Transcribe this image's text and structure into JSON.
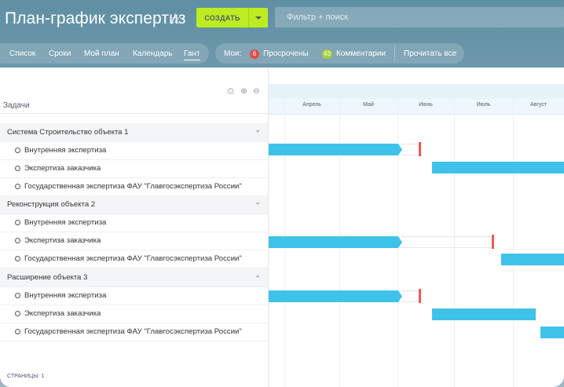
{
  "header": {
    "title": "План-график экспертиз",
    "create_label": "СОЗДАТЬ",
    "search_placeholder": "Фильтр + поиск"
  },
  "nav": {
    "items": [
      {
        "label": "Список"
      },
      {
        "label": "Сроки"
      },
      {
        "label": "Мой план"
      },
      {
        "label": "Календарь"
      },
      {
        "label": "Гант",
        "active": true
      }
    ]
  },
  "counters": {
    "my_label": "Мои:",
    "overdue_count": "6",
    "overdue_label": "Просрочены",
    "comments_count": "43",
    "comments_label": "Комментарии",
    "read_all_label": "Прочитать все",
    "colors": {
      "overdue": "#e04b4b",
      "comments": "#a6cf3a"
    }
  },
  "tasks": {
    "header": "Задачи",
    "groups": [
      {
        "name": "Система Строительство объекта 1",
        "items": [
          {
            "name": "Внутренняя экспертиза"
          },
          {
            "name": "Экспертиза заказчика"
          },
          {
            "name": "Государственная экспертиза ФАУ \"Главгосэкспертиза России\""
          }
        ]
      },
      {
        "name": "Реконструкция объекта 2",
        "items": [
          {
            "name": "Внутренняя экспертиза"
          },
          {
            "name": "Экспертиза заказчика"
          },
          {
            "name": "Государственная экспертиза ФАУ \"Главгосэкспертиза России\""
          }
        ]
      },
      {
        "name": "Расширение объекта 3",
        "items": [
          {
            "name": "Внутренняя экспертиза"
          },
          {
            "name": "Экспертиза заказчика"
          },
          {
            "name": "Государственная экспертиза ФАУ \"Главгосэкспертиза России\""
          }
        ]
      }
    ],
    "pages_label": "СТРАНИЦЫ: 1"
  },
  "gantt": {
    "months": [
      "Апрель",
      "Май",
      "Июнь",
      "Июль",
      "Август"
    ],
    "bar_color": "#3fc2ea",
    "deadline_color": "#f05858"
  }
}
